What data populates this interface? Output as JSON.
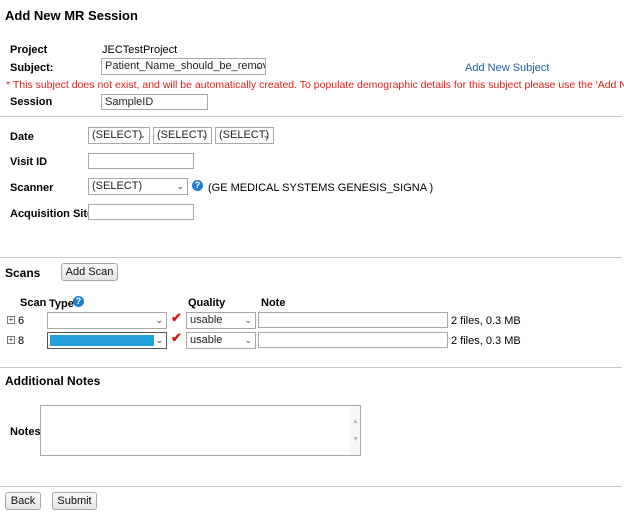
{
  "page": {
    "title": "Add New MR Session"
  },
  "project": {
    "label": "Project",
    "value": "JECTestProject"
  },
  "subject": {
    "label": "Subject:",
    "value": "Patient_Name_should_be_removed",
    "add_link": "Add New Subject",
    "warning": "* This subject does not exist, and will be automatically created. To populate demographic details for this subject please use the 'Add New Subject' link."
  },
  "session": {
    "label": "Session",
    "value": "SampleID"
  },
  "date": {
    "label": "Date",
    "month": "(SELECT)",
    "day": "(SELECT)",
    "year": "(SELECT)"
  },
  "visit": {
    "label": "Visit ID",
    "value": ""
  },
  "scanner": {
    "label": "Scanner",
    "value": "(SELECT)",
    "help": "?",
    "detected": "(GE MEDICAL SYSTEMS GENESIS_SIGNA )"
  },
  "acquisition": {
    "label": "Acquisition Site",
    "value": ""
  },
  "scans": {
    "title": "Scans",
    "add_button": "Add Scan",
    "headers": {
      "scan": "Scan",
      "type": "Type",
      "quality": "Quality",
      "note": "Note"
    },
    "type_help": "?",
    "rows": [
      {
        "id": "6",
        "type": "",
        "type_selected": false,
        "quality": "usable",
        "note": "",
        "files": "2 files, 0.3 MB"
      },
      {
        "id": "8",
        "type": "",
        "type_selected": true,
        "quality": "usable",
        "note": "",
        "files": "2 files, 0.3 MB"
      }
    ],
    "highlight_color": "#26a0da"
  },
  "notes": {
    "title": "Additional Notes",
    "label": "Notes",
    "value": ""
  },
  "actions": {
    "back": "Back",
    "submit": "Submit"
  },
  "icons": {
    "chevron": "⌄",
    "check": "✔",
    "expand": "+"
  }
}
